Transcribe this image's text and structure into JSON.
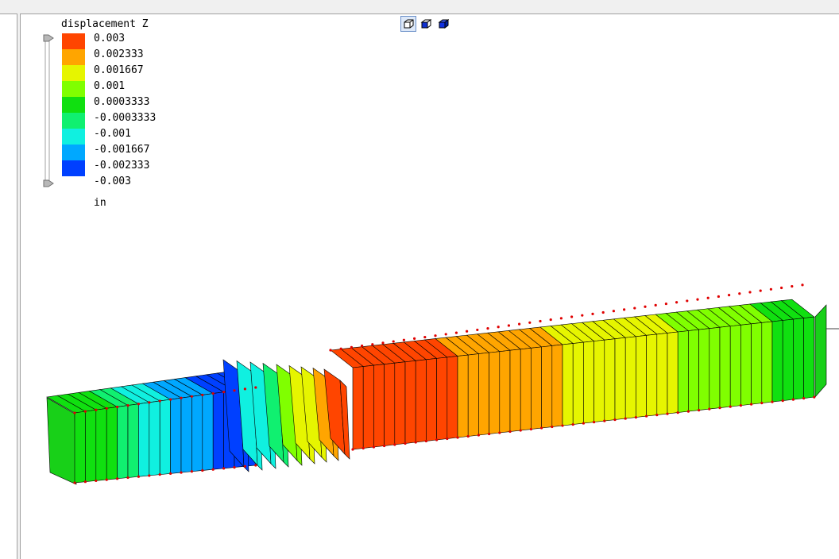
{
  "legend": {
    "title": "displacement Z",
    "units": "in",
    "labels": [
      "0.003",
      "0.002333",
      "0.001667",
      "0.001",
      "0.0003333",
      "-0.0003333",
      "-0.001",
      "-0.001667",
      "-0.002333",
      "-0.003"
    ],
    "colors": [
      "#ff4500",
      "#ffa500",
      "#e6f500",
      "#80ff00",
      "#10e010",
      "#10f070",
      "#10f0e0",
      "#00a8ff",
      "#0040ff"
    ]
  },
  "view_toolbar": {
    "buttons": [
      {
        "icon": "wireframe-cube-icon",
        "active": true
      },
      {
        "icon": "shaded-cube-icon",
        "active": false
      },
      {
        "icon": "solid-cube-icon",
        "active": false
      }
    ]
  }
}
